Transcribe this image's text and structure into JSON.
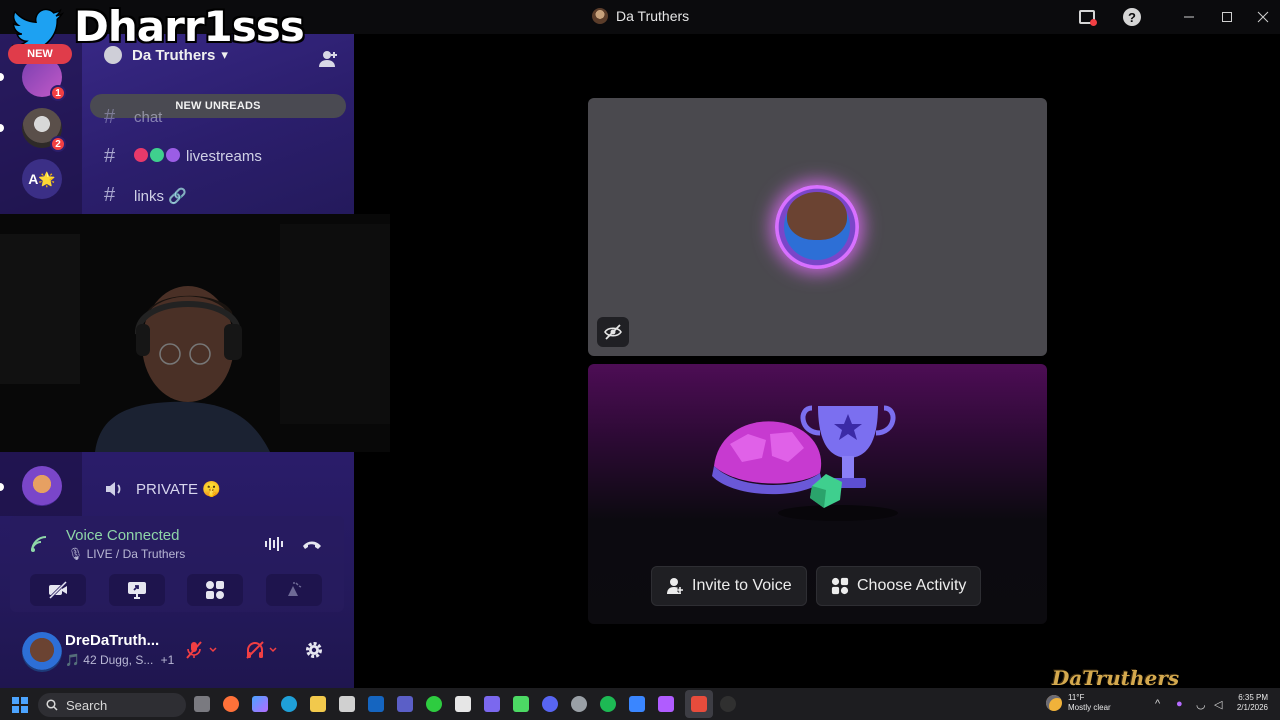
{
  "window": {
    "title": "Da Truthers"
  },
  "overlay": {
    "watermark_name": "Dharr1sss",
    "new_label": "NEW",
    "signature": "DaTruthers"
  },
  "servers": [
    {
      "name": "server-1",
      "badge": "1"
    },
    {
      "name": "server-2",
      "badge": "2"
    },
    {
      "name": "server-a",
      "label": "A🌟"
    }
  ],
  "server_header": {
    "name": "Da Truthers",
    "chevron": "⌄"
  },
  "new_unreads": "NEW UNREADS",
  "channels": [
    {
      "name": "chat",
      "partial": true
    },
    {
      "name": "livestreams"
    },
    {
      "name": "links 🔗"
    }
  ],
  "voice_channel": {
    "name": "PRIVATE 🤫"
  },
  "voice_status": {
    "status": "Voice Connected",
    "location": "🎙 LIVE / Da Truthers"
  },
  "user": {
    "name": "DreDaTruth...",
    "status": "🎵 42 Dugg, S...",
    "extra": "+1"
  },
  "stage": {
    "invite_label": "Invite to Voice",
    "activity_label": "Choose Activity"
  },
  "taskbar": {
    "search_label": "Search",
    "weather_temp": "11°F",
    "weather_desc": "Mostly clear",
    "time": "6:35 PM",
    "date": "2/1/2026"
  },
  "colors": {
    "accent_purple": "#2b1e6c",
    "voice_green": "#8fd6a8",
    "badge_red": "#f23f43",
    "tile_gray": "#4a494e"
  }
}
